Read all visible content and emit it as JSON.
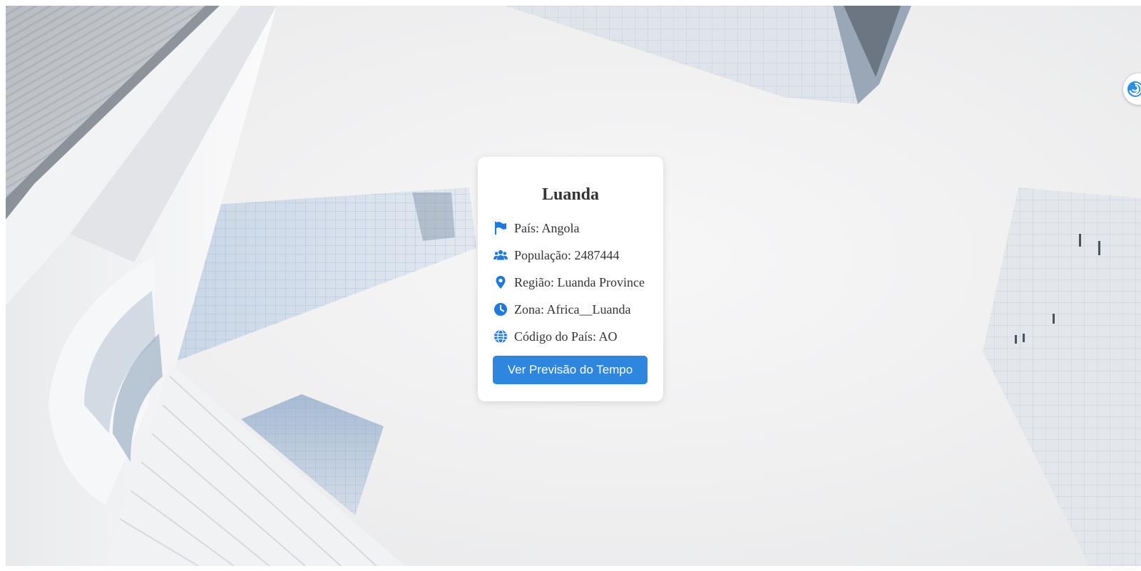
{
  "city": {
    "name": "Luanda",
    "fields": [
      {
        "label": "País: Angola",
        "icon": "flag-icon"
      },
      {
        "label": "População: 2487444",
        "icon": "users-icon"
      },
      {
        "label": "Região: Luanda Province",
        "icon": "map-marker-icon"
      },
      {
        "label": "Zona: Africa__Luanda",
        "icon": "clock-icon"
      },
      {
        "label": "Código do País: AO",
        "icon": "globe-icon"
      }
    ],
    "button_label": "Ver Previsão do Tempo"
  },
  "colors": {
    "accent": "#2e86de",
    "icon": "#1f7ae0",
    "text": "#333333",
    "card_bg": "#ffffff"
  },
  "background": {
    "description_icon": "building-skyline-image"
  },
  "side_widget": {
    "icon": "swirl-extension-icon"
  }
}
